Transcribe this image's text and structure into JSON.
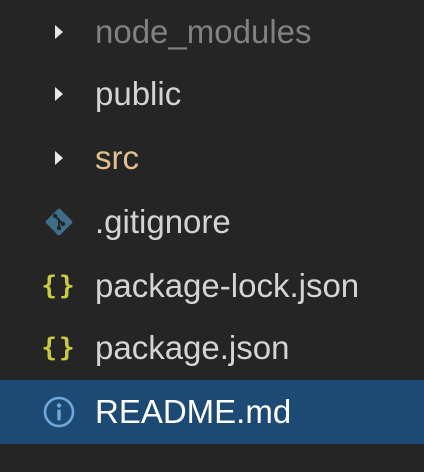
{
  "explorer": {
    "items": [
      {
        "label": "node_modules",
        "kind": "folder",
        "icon": "chevron-right-icon",
        "color": "#818181"
      },
      {
        "label": "public",
        "kind": "folder",
        "icon": "chevron-right-icon",
        "color": "#d4d4d4"
      },
      {
        "label": "src",
        "kind": "folder",
        "icon": "chevron-right-icon",
        "color": "#e2c08d"
      },
      {
        "label": ".gitignore",
        "kind": "file",
        "icon": "git-icon",
        "color": "#d4d4d4"
      },
      {
        "label": "package-lock.json",
        "kind": "file",
        "icon": "json-braces-icon",
        "color": "#d4d4d4"
      },
      {
        "label": "package.json",
        "kind": "file",
        "icon": "json-braces-icon",
        "color": "#d4d4d4"
      },
      {
        "label": "README.md",
        "kind": "file",
        "icon": "info-icon",
        "color": "#ffffff",
        "selected": true
      }
    ],
    "braces_glyph": "{}",
    "colors": {
      "background": "#252526",
      "selection": "#1d4a74",
      "chevron": "#e8e8e8",
      "git_icon": "#3f6e8a",
      "json_icon": "#cbcb41",
      "info_icon": "#6fa8dc"
    }
  }
}
